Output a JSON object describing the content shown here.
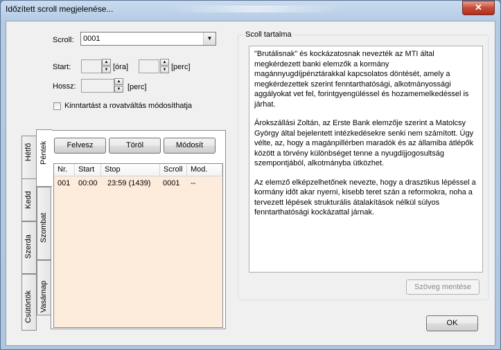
{
  "window": {
    "title": "Időzített scroll megjelenése...",
    "close_label": "✕"
  },
  "form": {
    "scroll_label": "Scroll:",
    "scroll_value": "0001",
    "start_label": "Start:",
    "ora_unit": "[óra]",
    "perc_unit": "[perc]",
    "hossz_label": "Hossz:",
    "hossz_unit": "[perc]",
    "checkbox_label": "Kinntartást a rovatváltás módosíthatja",
    "checkbox_checked": false
  },
  "tabs": {
    "left_column": [
      "Hétfő",
      "Kedd",
      "Szerda",
      "Csütörtök"
    ],
    "right_column": [
      "Péntek",
      "Szombat",
      "Vasárnap"
    ],
    "active": "Péntek"
  },
  "buttons": {
    "felvesz": "Felvesz",
    "torol": "Töröl",
    "modosit": "Módosít",
    "save_text": "Szöveg mentése",
    "ok": "OK"
  },
  "schedule": {
    "columns": [
      "Nr.",
      "Start",
      "Stop",
      "Scroll",
      "Mod."
    ],
    "rows": [
      {
        "nr": "001",
        "start": "00:00",
        "stop": "23:59 (1439)",
        "scroll": "0001",
        "mod": "--"
      }
    ]
  },
  "content": {
    "group_title": "Scoll tartalma",
    "paragraphs": [
      "\"Brutálisnak\" és kockázatosnak nevezték az MTI által megkérdezett banki elemzők a kormány magánnyugdíjpénztárakkal kapcsolatos döntését, amely a megkérdezettek szerint fenntarthatósági, alkotmányossági aggályokat vet fel, forintgyengüléssel és hozamemelkedéssel is járhat.",
      "Árokszállási Zoltán, az Erste Bank elemzője szerint a Matolcsy György által bejelentett intézkedésekre senki nem számított. Úgy vélte, az, hogy a magánpillérben maradók és az államiba átlépők között a törvény különbséget tenne a nyugdíjjogosultság szempontjából, alkotmányba ütközhet.",
      "Az elemző elképzelhetőnek nevezte, hogy a drasztikus lépéssel a kormány időt akar nyerni, kisebb teret szán a reformokra, noha a tervezett lépések strukturális átalakítások nélkül súlyos fenntarthatósági kockázattal járnak."
    ]
  }
}
